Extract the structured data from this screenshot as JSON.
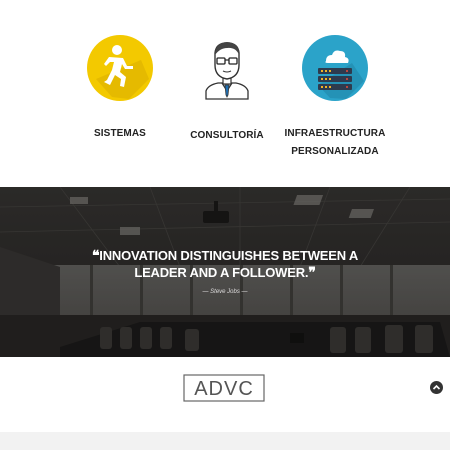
{
  "services": [
    {
      "label": "SISTEMAS",
      "icon": "running-person-icon",
      "color": "#f3c900"
    },
    {
      "label": "CONSULTORÍA",
      "icon": "consultant-avatar-icon",
      "color": "#ffffff"
    },
    {
      "label": "INFRAESTRUCTURA PERSONALIZADA",
      "icon": "cloud-servers-icon",
      "color": "#2ba3c9"
    }
  ],
  "quote": {
    "open_mark": "❝",
    "text": "INNOVATION DISTINGUISHES BETWEEN A LEADER AND A FOLLOWER.",
    "close_mark": "❞",
    "author": "— Steve Jobs —"
  },
  "footer": {
    "logo_text": "ADVC",
    "scroll_top_icon": "chevron-up-icon"
  }
}
